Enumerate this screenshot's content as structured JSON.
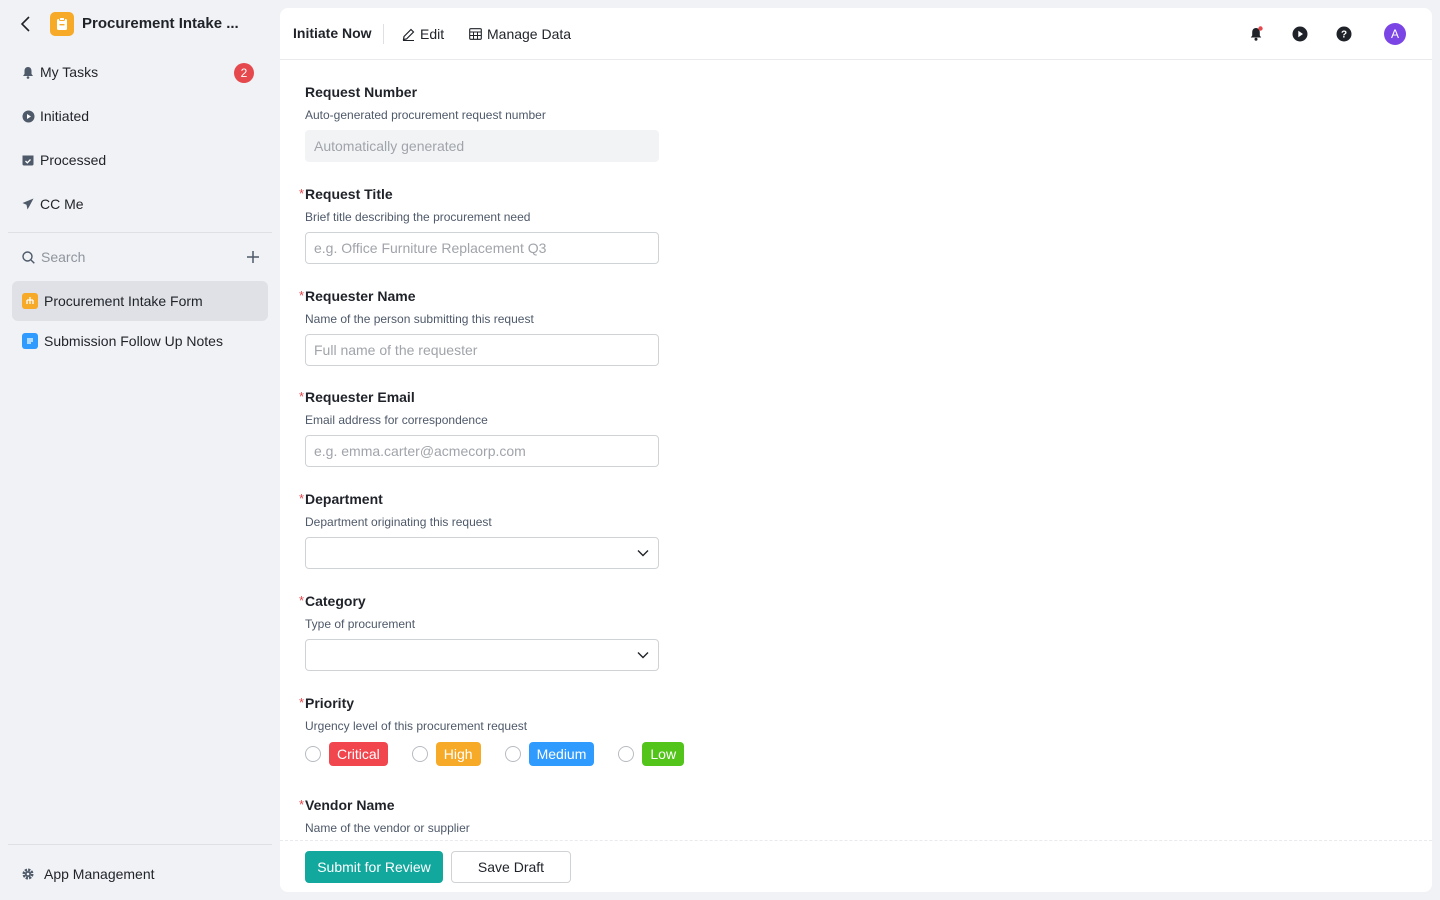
{
  "app": {
    "title": "Procurement Intake ...",
    "logo_color": "#f7a928"
  },
  "nav": [
    {
      "label": "My Tasks",
      "icon": "bell-icon",
      "badge": "2"
    },
    {
      "label": "Initiated",
      "icon": "play-circle-icon"
    },
    {
      "label": "Processed",
      "icon": "check-calendar-icon"
    },
    {
      "label": "CC Me",
      "icon": "send-icon"
    }
  ],
  "search": {
    "placeholder": "Search"
  },
  "forms": [
    {
      "label": "Procurement Intake Form",
      "icon": "form-icon",
      "color": "#f7a928",
      "active": true
    },
    {
      "label": "Submission Follow Up Notes",
      "icon": "document-icon",
      "color": "#2f9bff",
      "active": false
    }
  ],
  "footer_nav": {
    "label": "App Management"
  },
  "topbar": {
    "initiate": "Initiate Now",
    "edit": "Edit",
    "manage": "Manage Data",
    "avatar": "A"
  },
  "form": {
    "request_number": {
      "label": "Request Number",
      "desc": "Auto-generated procurement request number",
      "value": "Automatically generated"
    },
    "request_title": {
      "label": "Request Title",
      "desc": "Brief title describing the procurement need",
      "placeholder": "e.g. Office Furniture Replacement Q3"
    },
    "requester_name": {
      "label": "Requester Name",
      "desc": "Name of the person submitting this request",
      "placeholder": "Full name of the requester"
    },
    "requester_email": {
      "label": "Requester Email",
      "desc": "Email address for correspondence",
      "placeholder": "e.g. emma.carter@acmecorp.com"
    },
    "department": {
      "label": "Department",
      "desc": "Department originating this request"
    },
    "category": {
      "label": "Category",
      "desc": "Type of procurement"
    },
    "priority": {
      "label": "Priority",
      "desc": "Urgency level of this procurement request",
      "options": [
        {
          "label": "Critical",
          "color": "#f2464f"
        },
        {
          "label": "High",
          "color": "#f7a928"
        },
        {
          "label": "Medium",
          "color": "#2f9bff"
        },
        {
          "label": "Low",
          "color": "#52c41a"
        }
      ]
    },
    "vendor_name": {
      "label": "Vendor Name",
      "desc": "Name of the vendor or supplier"
    },
    "required_mark": "*"
  },
  "actions": {
    "submit": "Submit for Review",
    "draft": "Save Draft"
  }
}
